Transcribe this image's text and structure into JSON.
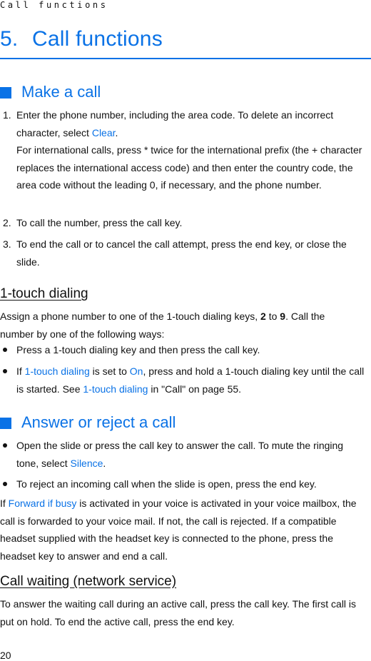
{
  "running_head": "Call functions",
  "chapter": {
    "number": "5.",
    "title": "Call functions"
  },
  "make_call": {
    "heading": "Make a call",
    "steps": [
      {
        "num": "1.",
        "text_before": "Enter the phone number, including the area code. To delete an incorrect character, select ",
        "link": "Clear",
        "text_after": "."
      },
      {
        "text": "For international calls, press * twice for the international prefix (the + character replaces the international access code) and then enter the country code, the area code without the leading 0, if necessary, and the phone number."
      },
      {
        "num": "2.",
        "text": "To call the number, press the call key."
      },
      {
        "num": "3.",
        "text": "To end the call or to cancel the call attempt, press the end key, or close the slide."
      }
    ]
  },
  "one_touch": {
    "heading": "1-touch dialing",
    "intro_before": "Assign a phone number to one of the 1-touch dialing keys, ",
    "key_from": "2",
    "intro_mid": " to ",
    "key_to": "9",
    "intro_after": ". Call the number by one of the following ways:",
    "bullets": [
      {
        "text": "Press a 1-touch dialing key and then press the call key."
      },
      {
        "p1": "If ",
        "link1": "1-touch dialing",
        "p2": " is set to ",
        "link2": "On",
        "p3": ", press and hold a 1-touch dialing key until the call is started. See ",
        "link3": "1-touch dialing",
        "p4": " in \"Call\" on page 55."
      }
    ]
  },
  "answer": {
    "heading": "Answer or reject a call",
    "bullets": [
      {
        "text_before": "Open the slide or press the call key to answer the call. To mute the ringing tone, select ",
        "link": "Silence",
        "text_after": "."
      },
      {
        "text": "To reject an incoming call when the slide is open, press the end key."
      }
    ],
    "para_before": "If ",
    "para_link": "Forward if busy",
    "para_after": " is activated in your voice is activated in your voice mailbox, the call is forwarded to your voice mail. If not, the call is rejected. If a compatible headset supplied with the headset key is connected to the phone, press the headset key to answer and end a call."
  },
  "call_waiting": {
    "heading": "Call waiting (network service)",
    "text": "To answer the waiting call during an active call, press the call key. The first call is put on hold. To end the active call, press the end key."
  },
  "page_number": "20",
  "colors": {
    "accent": "#0a72e6",
    "text": "#111111"
  }
}
